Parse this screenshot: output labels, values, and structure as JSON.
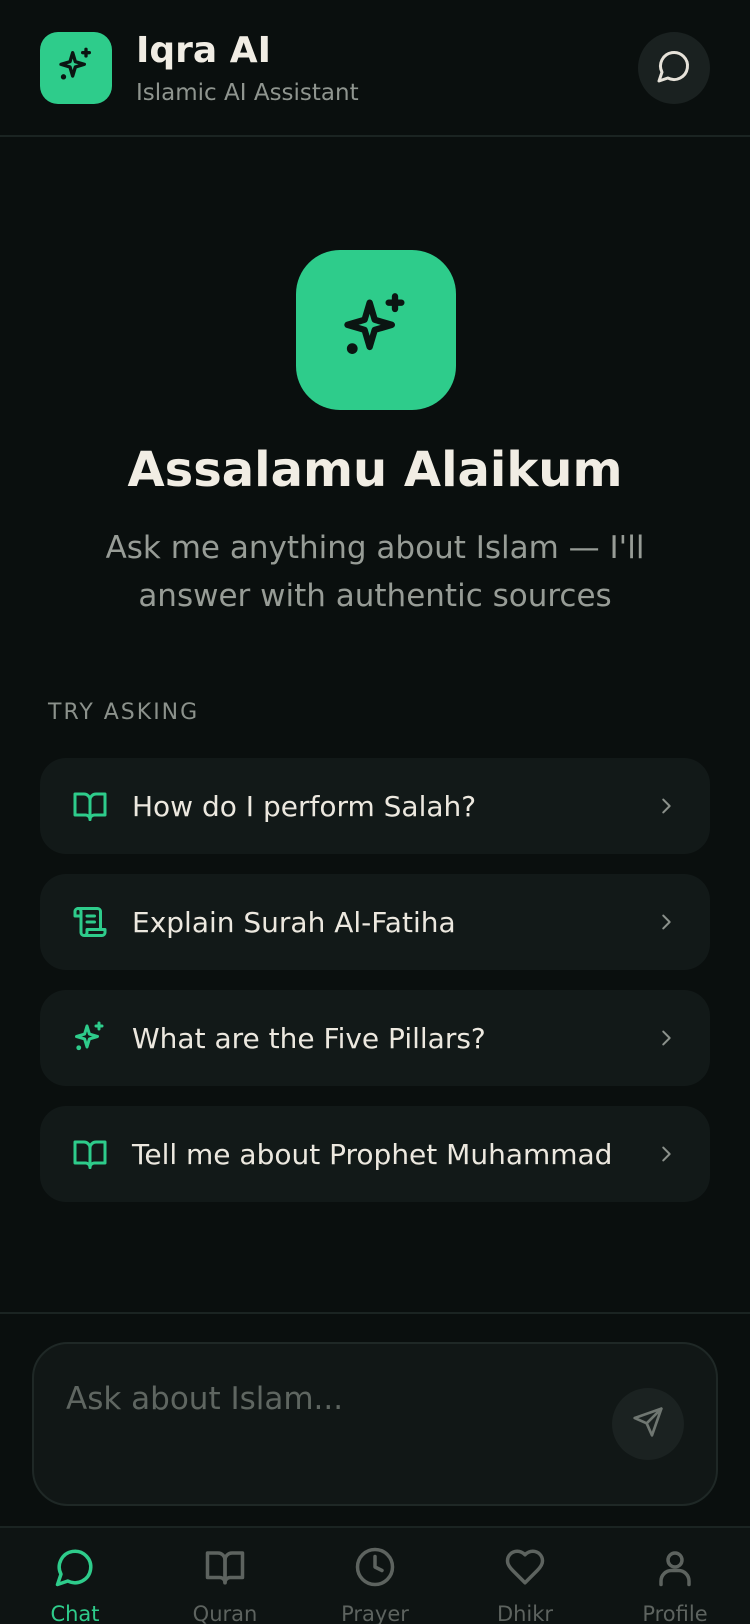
{
  "header": {
    "title": "Iqra AI",
    "subtitle": "Islamic AI Assistant"
  },
  "hero": {
    "greeting": "Assalamu Alaikum",
    "intro": "Ask me anything about Islam — I'll answer with authentic sources"
  },
  "suggestions": {
    "section_label": "TRY ASKING",
    "items": [
      {
        "label": "How do I perform Salah?",
        "icon": "book-open-icon"
      },
      {
        "label": "Explain Surah Al-Fatiha",
        "icon": "scroll-icon"
      },
      {
        "label": "What are the Five Pillars?",
        "icon": "sparkles-icon"
      },
      {
        "label": "Tell me about Prophet Muhammad",
        "icon": "book-open-icon"
      }
    ]
  },
  "composer": {
    "placeholder": "Ask about Islam..."
  },
  "tabs": [
    {
      "label": "Chat",
      "icon": "chat-bubble-icon",
      "active": true
    },
    {
      "label": "Quran",
      "icon": "book-open-icon",
      "active": false
    },
    {
      "label": "Prayer",
      "icon": "clock-icon",
      "active": false
    },
    {
      "label": "Dhikr",
      "icon": "heart-icon",
      "active": false
    },
    {
      "label": "Profile",
      "icon": "user-icon",
      "active": false
    }
  ],
  "colors": {
    "background": "#0a0f0e",
    "accent": "#2ecc8b",
    "card": "#121918",
    "text_primary": "#f1ede4",
    "text_muted": "#979c96"
  }
}
